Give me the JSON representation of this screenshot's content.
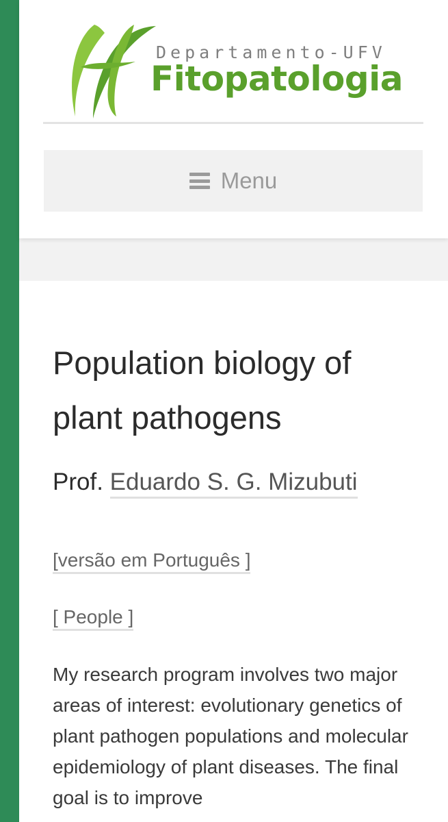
{
  "header": {
    "logo_subtitle": "Departamento-UFV",
    "logo_title": "Fitopatologia",
    "menu_label": "Menu"
  },
  "article": {
    "title": "Population biology of plant pathogens",
    "prof_prefix": "Prof.",
    "prof_name": "Eduardo S. G. Mizubuti",
    "portuguese_link": "[versão em Português ]",
    "people_link": "[ People ]",
    "body": "My research program involves two major areas of interest: evolutionary genetics of plant pathogen populations and molecular epidemiology of plant diseases. The final goal is to improve"
  },
  "colors": {
    "rail": "#2e8b57",
    "logo_green": "#5aa02c",
    "logo_grey": "#7f7f7f"
  },
  "icons": [
    "logo-leaf-icon",
    "hamburger-menu-icon"
  ]
}
